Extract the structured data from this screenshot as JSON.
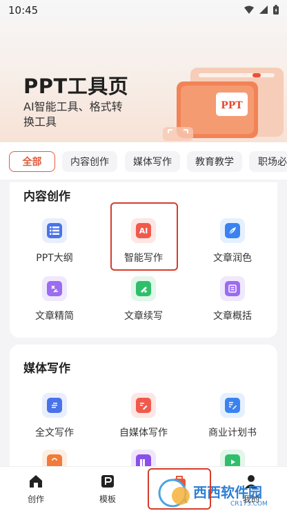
{
  "status": {
    "time": "10:45"
  },
  "hero": {
    "title": "PPT工具页",
    "subtitle": "AI智能工具、格式转换工具",
    "art_badge": "PPT"
  },
  "tabs": [
    {
      "label": "全部",
      "active": true
    },
    {
      "label": "内容创作"
    },
    {
      "label": "媒体写作"
    },
    {
      "label": "教育教学"
    },
    {
      "label": "职场必"
    }
  ],
  "sections": [
    {
      "title": "内容创作",
      "items": [
        {
          "label": "PPT大纲",
          "icon": "outline-list-icon",
          "color": "#4a73e8"
        },
        {
          "label": "智能写作",
          "icon": "ai-icon",
          "color": "#ef5a4c",
          "icon_text": "AI"
        },
        {
          "label": "文章润色",
          "icon": "feather-icon",
          "color": "#3b82f0"
        },
        {
          "label": "文章精简",
          "icon": "compress-icon",
          "color": "#9b6cf0"
        },
        {
          "label": "文章续写",
          "icon": "continue-write-icon",
          "color": "#2fbf6a"
        },
        {
          "label": "文章概括",
          "icon": "summary-icon",
          "color": "#9b6cf0"
        }
      ]
    },
    {
      "title": "媒体写作",
      "items": [
        {
          "label": "全文写作",
          "icon": "document-icon",
          "color": "#4a73e8"
        },
        {
          "label": "自媒体写作",
          "icon": "edit-doc-icon",
          "color": "#ef5a4c"
        },
        {
          "label": "商业计划书",
          "icon": "plan-doc-icon",
          "color": "#3b82f0"
        },
        {
          "label": "",
          "icon": "bag-icon",
          "color": "#f27a3a"
        },
        {
          "label": "",
          "icon": "books-icon",
          "color": "#8a4fe8"
        },
        {
          "label": "",
          "icon": "video-play-icon",
          "color": "#2fbf6a"
        }
      ]
    }
  ],
  "bottom_nav": [
    {
      "label": "创作",
      "icon": "home-icon"
    },
    {
      "label": "模板",
      "icon": "template-icon"
    },
    {
      "label": "工具",
      "icon": "toolbox-icon"
    },
    {
      "label": "我的",
      "icon": "profile-icon"
    }
  ],
  "watermark": {
    "text": "西西软件园",
    "url_text": "CR173.COM"
  },
  "colors": {
    "accent": "#e25a3a",
    "highlight": "#d63b2a"
  }
}
